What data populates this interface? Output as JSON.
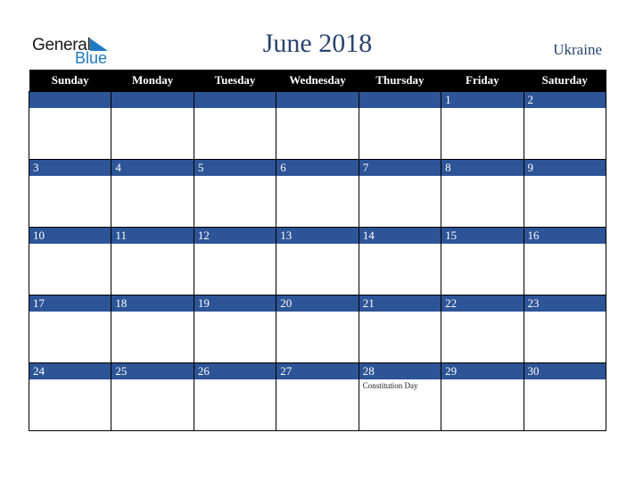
{
  "logo": {
    "line1": "General",
    "line2": "Blue"
  },
  "title": "June 2018",
  "country": "Ukraine",
  "colors": {
    "header_bg": "#000000",
    "day_bar": "#2d5496",
    "title": "#2a4470",
    "logo_blue": "#1f7bc1"
  },
  "weekdays": [
    "Sunday",
    "Monday",
    "Tuesday",
    "Wednesday",
    "Thursday",
    "Friday",
    "Saturday"
  ],
  "weeks": [
    [
      {
        "day": ""
      },
      {
        "day": ""
      },
      {
        "day": ""
      },
      {
        "day": ""
      },
      {
        "day": ""
      },
      {
        "day": "1"
      },
      {
        "day": "2"
      }
    ],
    [
      {
        "day": "3"
      },
      {
        "day": "4"
      },
      {
        "day": "5"
      },
      {
        "day": "6"
      },
      {
        "day": "7"
      },
      {
        "day": "8"
      },
      {
        "day": "9"
      }
    ],
    [
      {
        "day": "10"
      },
      {
        "day": "11"
      },
      {
        "day": "12"
      },
      {
        "day": "13"
      },
      {
        "day": "14"
      },
      {
        "day": "15"
      },
      {
        "day": "16"
      }
    ],
    [
      {
        "day": "17"
      },
      {
        "day": "18"
      },
      {
        "day": "19"
      },
      {
        "day": "20"
      },
      {
        "day": "21"
      },
      {
        "day": "22"
      },
      {
        "day": "23"
      }
    ],
    [
      {
        "day": "24"
      },
      {
        "day": "25"
      },
      {
        "day": "26"
      },
      {
        "day": "27"
      },
      {
        "day": "28",
        "event": "Constitution Day"
      },
      {
        "day": "29"
      },
      {
        "day": "30"
      }
    ]
  ]
}
